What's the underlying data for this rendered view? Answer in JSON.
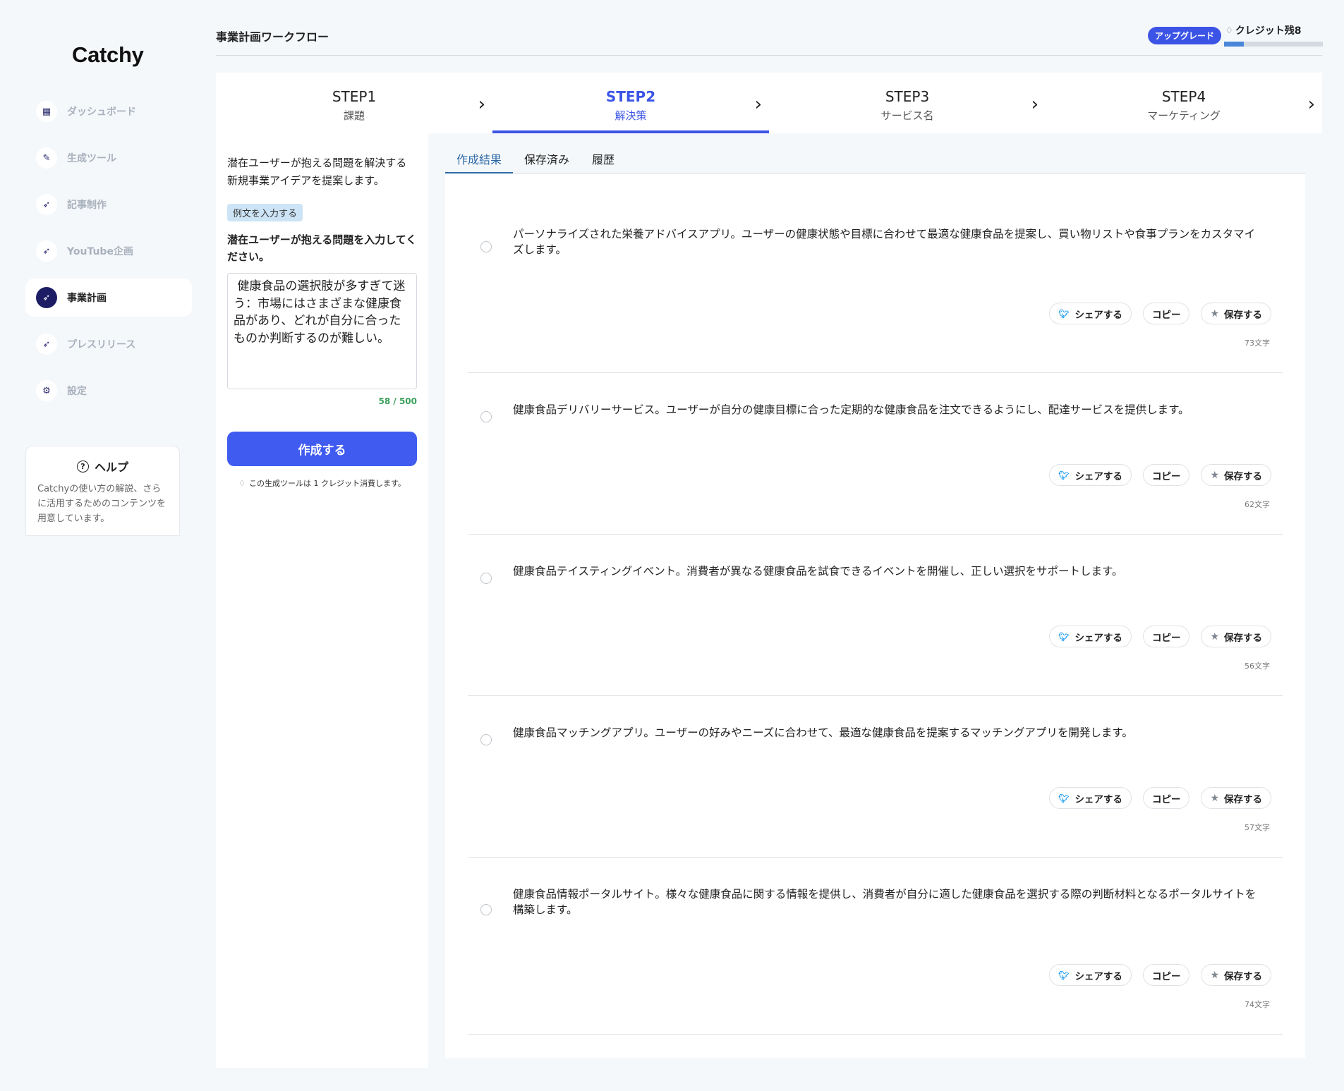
{
  "app": {
    "logo": "Catchy"
  },
  "sidebar": {
    "items": [
      {
        "label": "ダッシュボード",
        "icon": "grid-icon",
        "glyph": "▦",
        "active": false
      },
      {
        "label": "生成ツール",
        "icon": "wrench-icon",
        "glyph": "✎",
        "active": false
      },
      {
        "label": "記事制作",
        "icon": "rocket-icon",
        "glyph": "➶",
        "active": false
      },
      {
        "label": "YouTube企画",
        "icon": "rocket-icon",
        "glyph": "➶",
        "active": false
      },
      {
        "label": "事業計画",
        "icon": "rocket-icon",
        "glyph": "➶",
        "active": true
      },
      {
        "label": "プレスリリース",
        "icon": "rocket-icon",
        "glyph": "➶",
        "active": false
      },
      {
        "label": "設定",
        "icon": "gear-icon",
        "glyph": "⚙",
        "active": false
      }
    ],
    "help": {
      "title": "ヘルプ",
      "text": "Catchyの使い方の解説、さらに活用するためのコンテンツを用意しています。"
    }
  },
  "header": {
    "title": "事業計画ワークフロー",
    "upgrade_label": "アップグレード",
    "credits_label": "クレジット残8",
    "credit_progress": 0.2
  },
  "steps": [
    {
      "num": "STEP1",
      "name": "課題",
      "active": false
    },
    {
      "num": "STEP2",
      "name": "解決策",
      "active": true
    },
    {
      "num": "STEP3",
      "name": "サービス名",
      "active": false
    },
    {
      "num": "STEP4",
      "name": "マーケティング",
      "active": false
    }
  ],
  "input_panel": {
    "description": "潜在ユーザーが抱える問題を解決する新規事業アイデアを提案します。",
    "example_label": "例文を入力する",
    "field_label": "潜在ユーザーが抱える問題を入力してください。",
    "field_value": " 健康食品の選択肢が多すぎて迷う：市場にはさまざまな健康食品があり、どれが自分に合ったものか判断するのが難しい。",
    "char_count": "58 / 500",
    "create_label": "作成する",
    "credit_note": "この生成ツールは 1 クレジット消費します。"
  },
  "tabs": [
    {
      "label": "作成結果",
      "active": true
    },
    {
      "label": "保存済み",
      "active": false
    },
    {
      "label": "履歴",
      "active": false
    }
  ],
  "actions": {
    "share": "シェアする",
    "copy": "コピー",
    "save": "保存する"
  },
  "results": [
    {
      "text": "パーソナライズされた栄養アドバイスアプリ。ユーザーの健康状態や目標に合わせて最適な健康食品を提案し、買い物リストや食事プランをカスタマイズします。",
      "chars": "73文字"
    },
    {
      "text": "健康食品デリバリーサービス。ユーザーが自分の健康目標に合った定期的な健康食品を注文できるようにし、配達サービスを提供します。",
      "chars": "62文字"
    },
    {
      "text": "健康食品テイスティングイベント。消費者が異なる健康食品を試食できるイベントを開催し、正しい選択をサポートします。",
      "chars": "56文字"
    },
    {
      "text": "健康食品マッチングアプリ。ユーザーの好みやニーズに合わせて、最適な健康食品を提案するマッチングアプリを開発します。",
      "chars": "57文字"
    },
    {
      "text": "健康食品情報ポータルサイト。様々な健康食品に関する情報を提供し、消費者が自分に適した健康食品を選択する際の判断材料となるポータルサイトを構築します。",
      "chars": "74文字"
    }
  ]
}
